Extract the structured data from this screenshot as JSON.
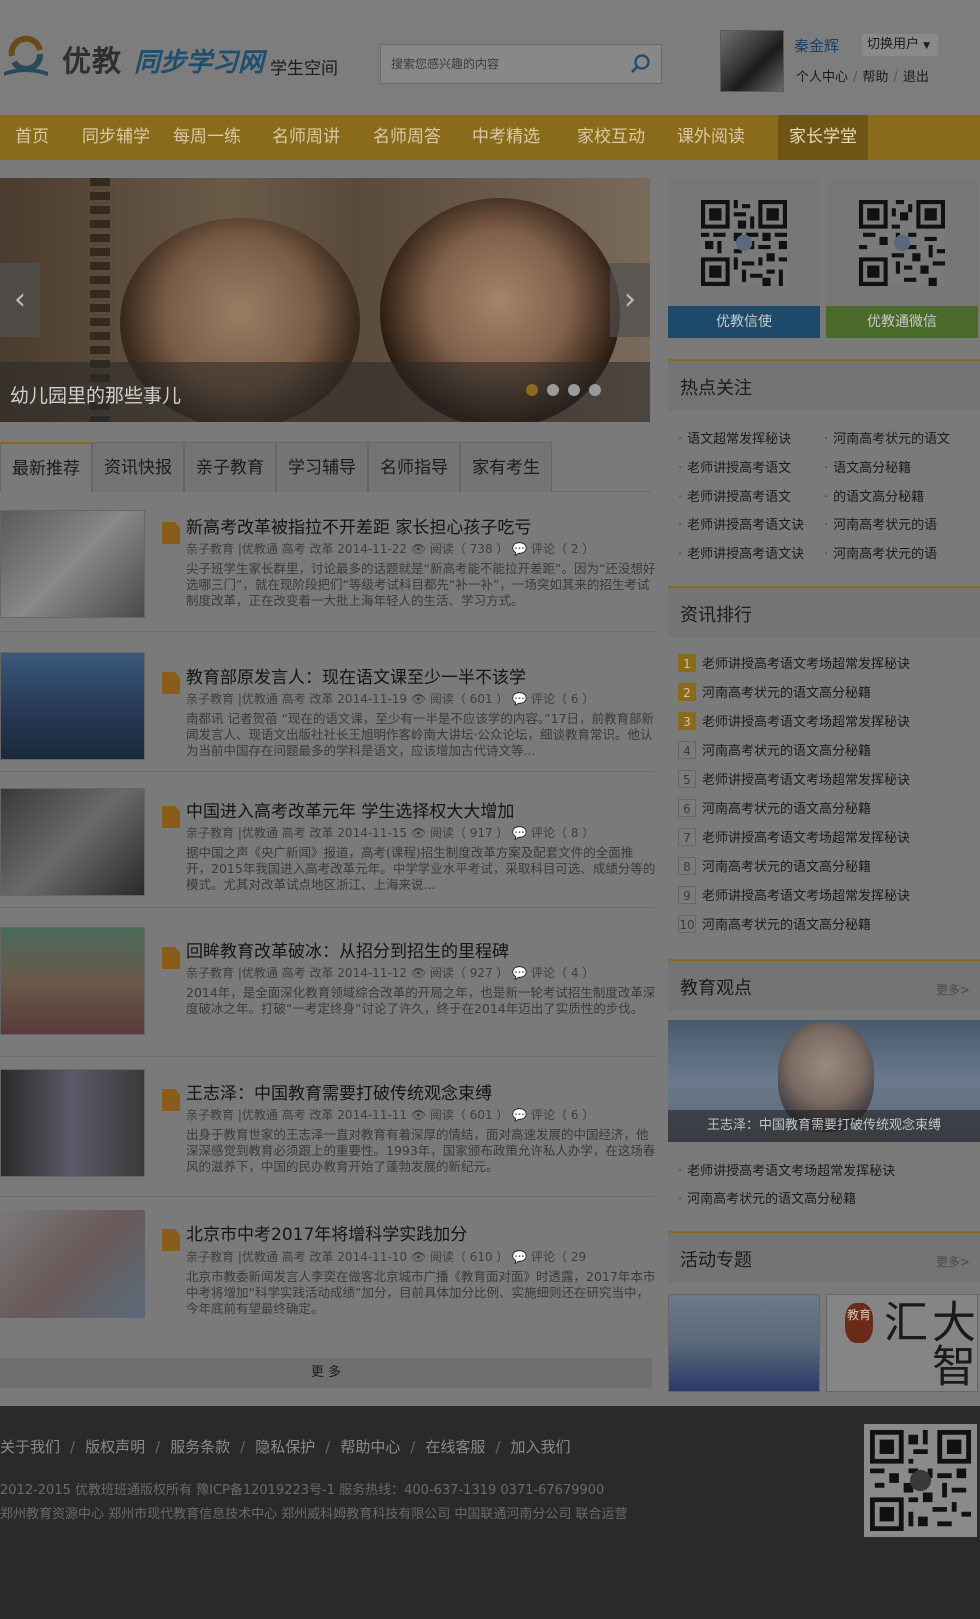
{
  "header": {
    "logo_text": "优教",
    "logo_brand": "同步学习网",
    "logo_sub": "学生空间",
    "search_placeholder": "搜索您感兴趣的内容",
    "user_name": "秦金辉",
    "switch_user": "切换用户",
    "links": [
      "个人中心",
      "帮助",
      "退出"
    ]
  },
  "nav": {
    "items": [
      "首页",
      "同步辅学",
      "每周一练",
      "名师周讲",
      "名师周答",
      "中考精选",
      "家校互动",
      "课外阅读",
      "家长学堂"
    ],
    "active": "家长学堂"
  },
  "banner": {
    "caption": "幼儿园里的那些事儿",
    "prev": "‹",
    "next": "›"
  },
  "tabs": [
    "最新推荐",
    "资讯快报",
    "亲子教育",
    "学习辅导",
    "名师指导",
    "家有考生"
  ],
  "articles": [
    {
      "title": "新高考改革被指拉不开差距 家长担心孩子吃亏",
      "meta": "亲子教育 |优教通 高考 改革 2014-11-22  👁 阅读（ 738 ）  💬 评论（ 2 ）",
      "summary": "尖子班学生家长群里，讨论最多的话题就是“新高考能不能拉开差距”。因为“还没想好选哪三门”，就在现阶段把们“等级考试科目都先“补一补”，一场突如其来的招生考试制度改革，正在改变着一大批上海年轻人的生活、学习方式。"
    },
    {
      "title": "教育部原发言人：现在语文课至少一半不该学",
      "meta": "亲子教育 |优教通 高考 改革 2014-11-19  👁 阅读（ 601 ）  💬 评论（ 6 ）",
      "summary": "南都讯 记者贺蓓 “现在的语文课，至少有一半是不应该学的内容。”17日，前教育部新闻发言人、现语文出版社社长王旭明作客岭南大讲坛·公众论坛，细谈教育常识。他认为当前中国存在问题最多的学科是语文，应该增加古代诗文等..."
    },
    {
      "title": "中国进入高考改革元年 学生选择权大大增加",
      "meta": "亲子教育 |优教通 高考 改革 2014-11-15  👁 阅读（ 917 ）  💬 评论（ 8 ）",
      "summary": "据中国之声《央广新闻》报道，高考(课程)招生制度改革方案及配套文件的全面推开，2015年我国进入高考改革元年。中学学业水平考试，采取科目可选、成绩分等的模式。尤其对改革试点地区浙江、上海来说..."
    },
    {
      "title": "回眸教育改革破冰：从招分到招生的里程碑",
      "meta": "亲子教育 |优教通 高考 改革 2014-11-12  👁 阅读（ 927 ）  💬 评论（ 4 ）",
      "summary": "2014年，是全面深化教育领域综合改革的开局之年，也是新一轮考试招生制度改革深度破冰之年。打破“一考定终身”讨论了许久，终于在2014年迈出了实质性的步伐。"
    },
    {
      "title": "王志泽：中国教育需要打破传统观念束缚",
      "meta": "亲子教育 |优教通 高考 改革 2014-11-11  👁 阅读（ 601 ）  💬 评论（ 6 ）",
      "summary": "出身于教育世家的王志泽一直对教育有着深厚的情结，面对高速发展的中国经济，他深深感觉到教育必须跟上的重要性。1993年，国家颁布政策允许私人办学，在这场春风的滋养下，中国的民办教育开始了蓬勃发展的新纪元。"
    },
    {
      "title": "北京市中考2017年将增科学实践加分",
      "meta": "亲子教育 |优教通 高考 改革 2014-11-10  👁 阅读（ 610 ）  💬 评论（ 29",
      "summary": "北京市教委新闻发言人李奕在做客北京城市广播《教育面对面》时透露，2017年本市中考将增加“科学实践活动成绩”加分，目前具体加分比例、实施细则还在研究当中，今年底前有望最终确定。"
    }
  ],
  "more_label": "更 多",
  "qr_cards": [
    {
      "label": "优教信使",
      "color": "#1d4a6a"
    },
    {
      "label": "优教通微信",
      "color": "#4a6a2a"
    }
  ],
  "hot": {
    "title": "热点关注",
    "left": [
      "语文超常发挥秘诀",
      "老师讲授高考语文",
      "老师讲授高考语文",
      "老师讲授高考语文诀",
      "老师讲授高考语文诀"
    ],
    "right": [
      "河南高考状元的语文",
      "语文高分秘籍",
      "的语文高分秘籍",
      "河南高考状元的语",
      "河南高考状元的语"
    ]
  },
  "ranking": {
    "title": "资讯排行",
    "items": [
      {
        "num": "1",
        "text": "老师讲授高考语文考场超常发挥秘诀"
      },
      {
        "num": "2",
        "text": "河南高考状元的语文高分秘籍"
      },
      {
        "num": "3",
        "text": "老师讲授高考语文考场超常发挥秘诀"
      },
      {
        "num": "4",
        "text": "河南高考状元的语文高分秘籍"
      },
      {
        "num": "5",
        "text": "老师讲授高考语文考场超常发挥秘诀"
      },
      {
        "num": "6",
        "text": "河南高考状元的语文高分秘籍"
      },
      {
        "num": "7",
        "text": "老师讲授高考语文考场超常发挥秘诀"
      },
      {
        "num": "8",
        "text": "河南高考状元的语文高分秘籍"
      },
      {
        "num": "9",
        "text": "老师讲授高考语文考场超常发挥秘诀"
      },
      {
        "num": "10",
        "text": "河南高考状元的语文高分秘籍"
      }
    ]
  },
  "opinion": {
    "title": "教育观点",
    "more": "更多>",
    "caption": "王志泽：中国教育需要打破传统观念束缚",
    "items": [
      "老师讲授高考语文考场超常发挥秘诀",
      "河南高考状元的语文高分秘籍"
    ]
  },
  "activity": {
    "title": "活动专题",
    "more": "更多>",
    "badge": "教育",
    "calligraphy": "大智汇"
  },
  "footer": {
    "links": [
      "关于我们",
      "版权声明",
      "服务条款",
      "隐私保护",
      "帮助中心",
      "在线客服",
      "加入我们"
    ],
    "copyright": "2012-2015 优教班班通版权所有  豫ICP备12019223号-1      服务热线：400-637-1319    0371-67679900",
    "orgs": "郑州教育资源中心    郑州市现代教育信息技术中心    郑州威科姆教育科技有限公司 中国联通河南分公司  联合运营"
  }
}
